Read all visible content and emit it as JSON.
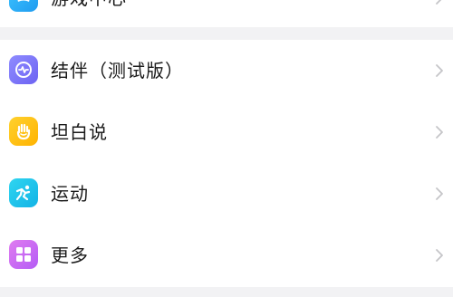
{
  "top_section": {
    "items": [
      {
        "label": "游戏中心",
        "icon": "gamepad-icon",
        "color": "#2aa9f5"
      }
    ]
  },
  "main_section": {
    "items": [
      {
        "label": "结伴（测试版）",
        "icon": "partner-wave-icon",
        "color": "#7b74f6"
      },
      {
        "label": "坦白说",
        "icon": "hand-icon",
        "color": "#ffc21a"
      },
      {
        "label": "运动",
        "icon": "runner-icon",
        "color": "#1fc3ec"
      },
      {
        "label": "更多",
        "icon": "grid-icon",
        "color": "#c66cf3"
      }
    ]
  },
  "colors": {
    "background": "#f2f2f4",
    "card": "#ffffff",
    "text": "#1a1a1a",
    "chevron": "#c5c5c8"
  }
}
